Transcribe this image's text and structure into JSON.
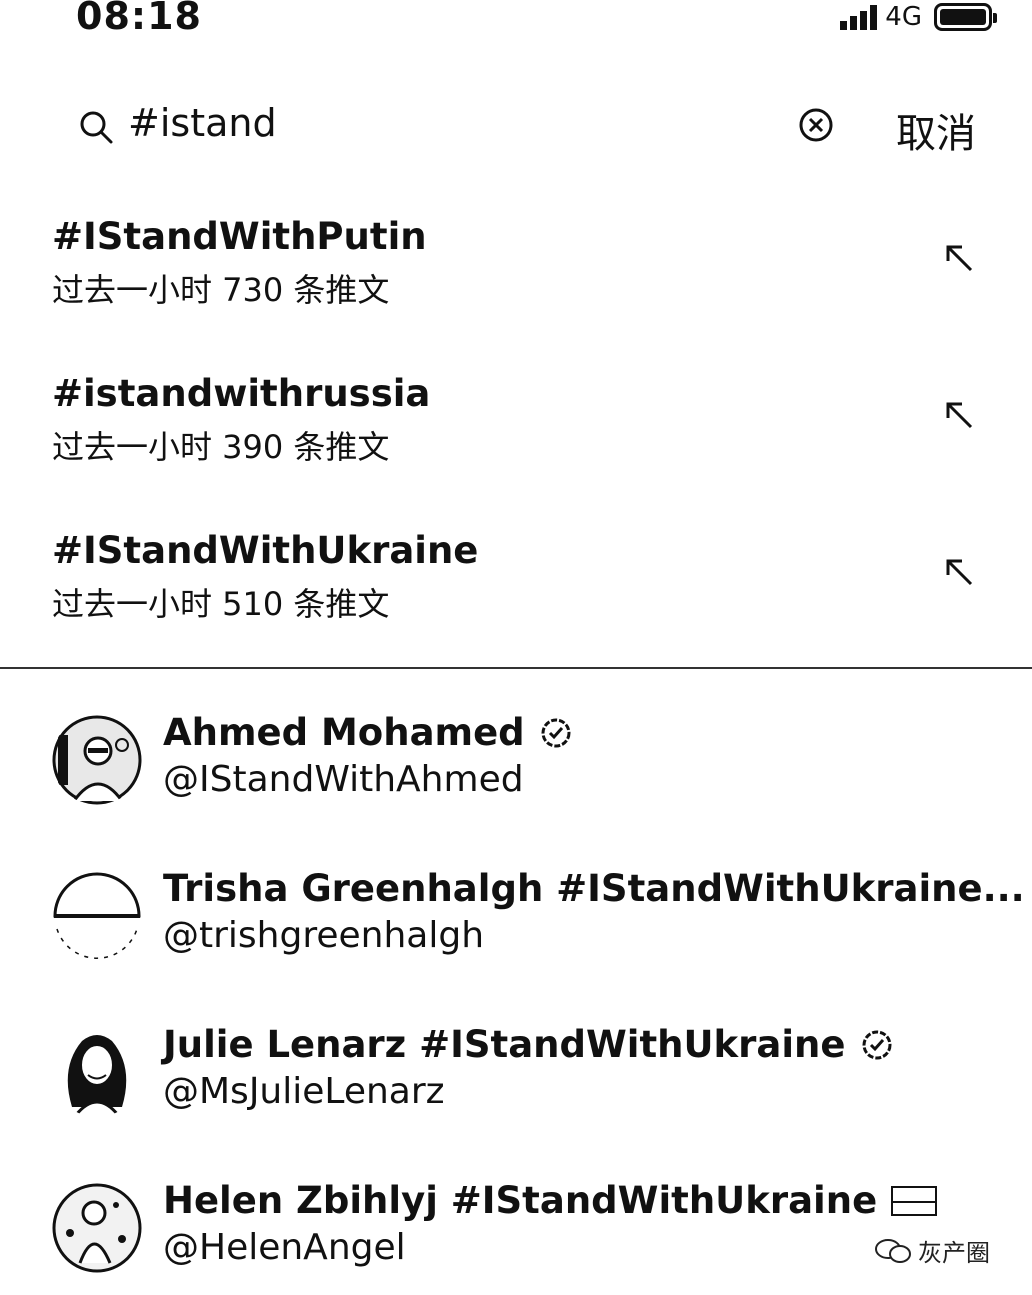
{
  "status_bar": {
    "time": "08:18",
    "network": "4G",
    "signal_icon": "signal-bars-icon",
    "battery_icon": "battery-icon"
  },
  "search": {
    "query": "#istand",
    "cancel_label": "取消"
  },
  "suggestions": [
    {
      "tag": "#IStandWithPutin",
      "meta": "过去一小时 730 条推文"
    },
    {
      "tag": "#istandwithrussia",
      "meta": "过去一小时 390 条推文"
    },
    {
      "tag": "#IStandWithUkraine",
      "meta": "过去一小时 510 条推文"
    }
  ],
  "users": [
    {
      "name": "Ahmed Mohamed",
      "handle": "@IStandWithAhmed",
      "verified": true
    },
    {
      "name": "Trisha Greenhalgh #IStandWithUkraine...",
      "handle": "@trishgreenhalgh",
      "verified": true
    },
    {
      "name": "Julie Lenarz #IStandWithUkraine",
      "handle": "@MsJulieLenarz",
      "verified": true
    },
    {
      "name": "Helen Zbihlyj #IStandWithUkraine",
      "handle": "@HelenAngel",
      "verified": false,
      "flag_icon": "flag-icon"
    }
  ],
  "watermark": "灰产圈"
}
